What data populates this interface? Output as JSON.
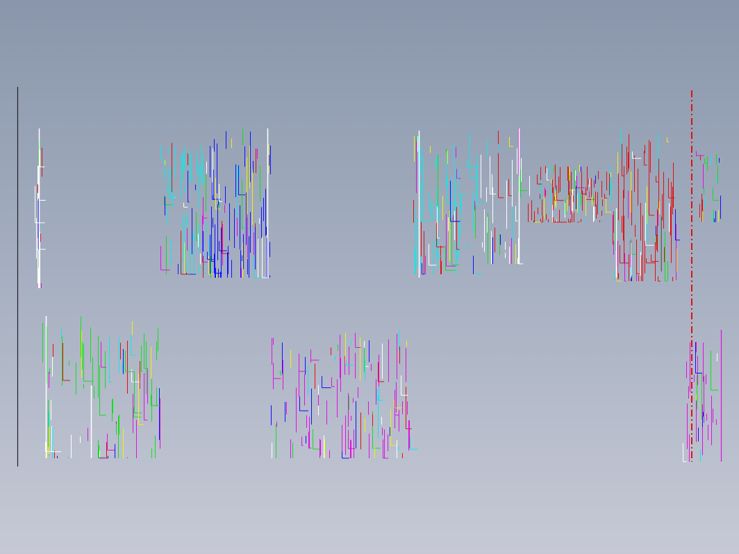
{
  "viewport": {
    "background_top": "#8996ab",
    "background_bottom": "#c6c9d5"
  },
  "palette": {
    "white": "#ffffff",
    "red": "#e01010",
    "green": "#10e020",
    "blue": "#1010ff",
    "cyan": "#10e8e8",
    "magenta": "#e010e0",
    "yellow": "#f0f010",
    "dark": "#202028"
  },
  "content": {
    "kind": "cad-wireframe-drawing",
    "has_text": false
  }
}
